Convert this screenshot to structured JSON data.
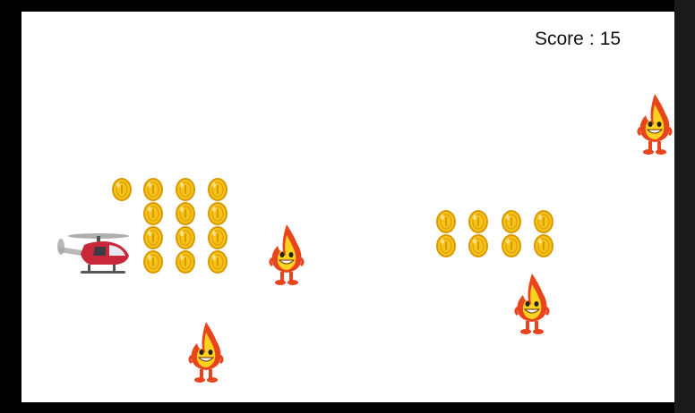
{
  "hud": {
    "score_label": "Score",
    "separator": ":",
    "score_value": "15"
  },
  "colors": {
    "background": "#ffffff",
    "frame": "#000000",
    "coin_fill": "#f6c21a",
    "coin_edge": "#d99a00",
    "flame_outer": "#e8451d",
    "flame_inner": "#ffd21f",
    "helicopter_body": "#c8283a"
  },
  "sprites": {
    "player": "helicopter-icon",
    "collectible": "coin-icon",
    "enemy": "fire-monster-icon"
  }
}
